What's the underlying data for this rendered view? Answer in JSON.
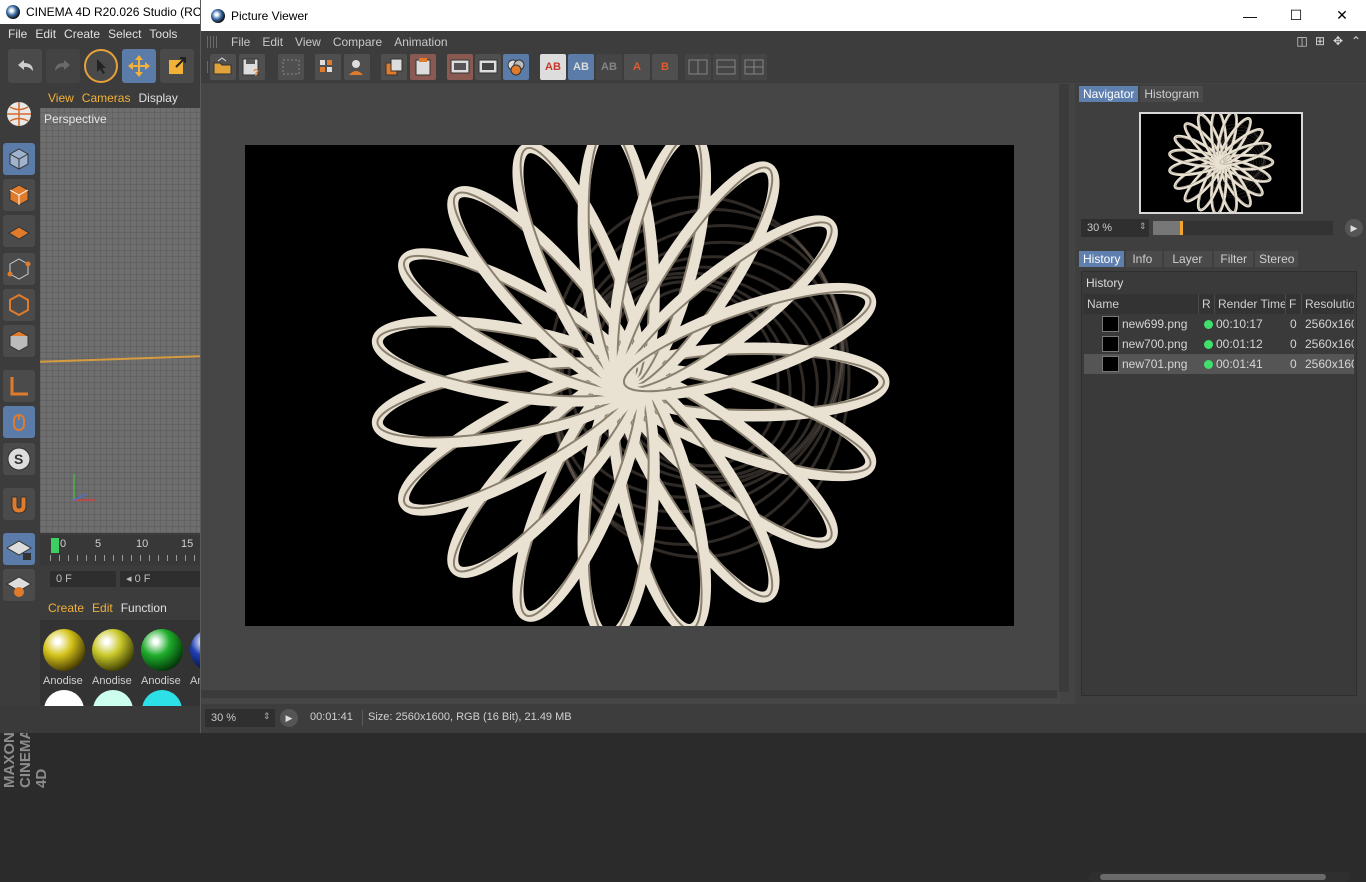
{
  "c4d": {
    "title": "CINEMA 4D R20.026 Studio (RC - ",
    "menu": [
      "File",
      "Edit",
      "Create",
      "Select",
      "Tools"
    ],
    "viewport_menu": [
      "View",
      "Cameras",
      "Display"
    ],
    "viewport_label": "Perspective",
    "timeline_ticks": [
      "0",
      "5",
      "10",
      "15"
    ],
    "frame_field": "0 F",
    "frame_field2": "◂ 0 F",
    "material_menu": [
      "Create",
      "Edit",
      "Function"
    ],
    "materials": [
      {
        "name": "Anodise",
        "color": "#d4c31a"
      },
      {
        "name": "Anodise",
        "color": "#c8c82a"
      },
      {
        "name": "Anodise",
        "color": "#1fae2c"
      },
      {
        "name": "An",
        "color": "#1e3fb0"
      }
    ],
    "brand": "MAXON CINEMA 4D"
  },
  "viewer": {
    "title": "Picture Viewer",
    "window_buttons": {
      "minimize": "—",
      "maximize": "☐",
      "close": "✕"
    },
    "menu": [
      "File",
      "Edit",
      "View",
      "Compare",
      "Animation"
    ],
    "toolbar_ab": {
      "ab": "AB",
      "a": "A",
      "b": "B"
    }
  },
  "side": {
    "top_tabs": [
      "Navigator",
      "Histogram"
    ],
    "zoom": "30 %",
    "zoom_fraction": 0.16,
    "bottom_tabs": [
      "History",
      "Info",
      "Layer",
      "Filter",
      "Stereo"
    ],
    "history_title": "History",
    "columns": {
      "name": "Name",
      "r": "R",
      "render_time": "Render Time",
      "f": "F",
      "resolution": "Resolutio"
    },
    "rows": [
      {
        "name": "new699.png",
        "time": "00:10:17",
        "f": "0",
        "res": "2560x160"
      },
      {
        "name": "new700.png",
        "time": "00:01:12",
        "f": "0",
        "res": "2560x160"
      },
      {
        "name": "new701.png",
        "time": "00:01:41",
        "f": "0",
        "res": "2560x160"
      }
    ]
  },
  "status": {
    "zoom": "30 %",
    "time": "00:01:41",
    "size": "Size: 2560x1600, RGB (16 Bit), 21.49 MB"
  }
}
